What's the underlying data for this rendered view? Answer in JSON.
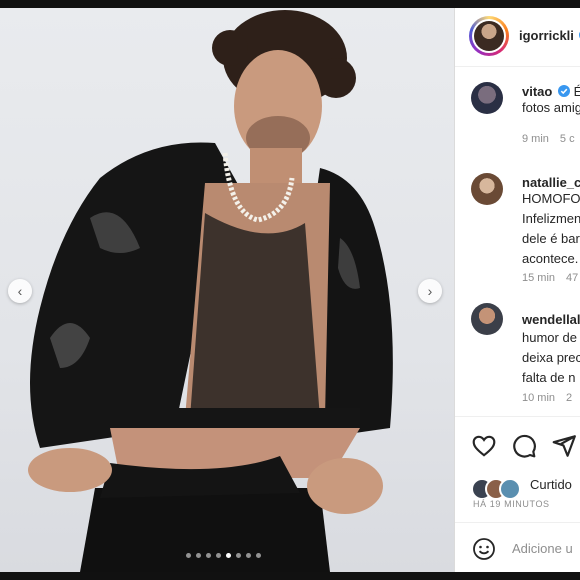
{
  "post": {
    "carousel": {
      "slide_count": 8,
      "active_slide": 5
    },
    "nav": {
      "prev": "‹",
      "next": "›"
    }
  },
  "header": {
    "username": "igorrickli"
  },
  "comments": [
    {
      "user": "vitao",
      "verified": true,
      "text_lines": [
        "É",
        "fotos amig"
      ],
      "time": "9 min",
      "extra": "5 c"
    },
    {
      "user": "natallie_c",
      "verified": false,
      "text_lines": [
        "HOMOFO",
        "Infelizmen",
        "dele é bar",
        "acontece."
      ],
      "time": "15 min",
      "extra": "47"
    },
    {
      "user": "wendellal",
      "verified": false,
      "text_lines": [
        "humor de",
        "deixa prec",
        "falta de n"
      ],
      "time": "10 min",
      "extra": "2"
    }
  ],
  "footer": {
    "liked_text": "Curtido",
    "time_ago": "HÁ 19 MINUTOS",
    "add_comment_placeholder": "Adicione u"
  },
  "colors": {
    "verified": "#3897f0",
    "text": "#262626",
    "muted": "#8e8e8e"
  }
}
